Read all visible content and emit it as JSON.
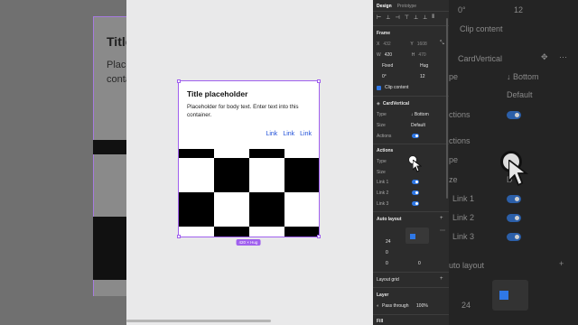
{
  "canvas": {
    "card_title": "Title placeholder",
    "card_body": "Placeholder for body text. Enter text into this container.",
    "links": [
      "Link",
      "Link",
      "Link"
    ],
    "size_tag": "420 × Hug"
  },
  "zoom_left": {
    "title": "Title",
    "body_line1": "Placeho",
    "body_line2": "contai"
  },
  "panel": {
    "tabs": [
      "Design",
      "Prototype"
    ],
    "frame_section": "Frame",
    "x_label": "X",
    "x_value": "432",
    "y_label": "Y",
    "y_value": "1608",
    "w_label": "W",
    "w_value": "420",
    "h_label": "H",
    "h_value": "470",
    "width_mode": "Fixed",
    "height_mode": "Hug",
    "rotation": "0°",
    "radius": "12",
    "clip_content": "Clip content",
    "component_name": "CardVertical",
    "type_label": "Type",
    "type_value": "↓ Bottom",
    "size_label": "Size",
    "size_value": "Default",
    "actions_label": "Actions",
    "actions_section": "Actions",
    "link1": "Link 1",
    "link2": "Link 2",
    "link3": "Link 3",
    "auto_layout": "Auto layout",
    "gap_value": "24",
    "pad_h": "0",
    "pad_v": "0",
    "pad_extra": "0",
    "layout_grid": "Layout grid",
    "layer_section": "Layer",
    "pass_through": "Pass through",
    "opacity": "100%",
    "fill_section": "Fill"
  },
  "zoom_right": {
    "rotation": "0°",
    "radius": "12",
    "clip_content": "Clip content",
    "component_name": "CardVertical",
    "type_partial": "pe",
    "type_value": "↓ Bottom",
    "size_value": "Default",
    "actions_partial": "ctions",
    "actions_section_partial": "ctions",
    "type2_partial": "pe",
    "size2_partial": "ze",
    "link1": "Link 1",
    "link2": "Link 2",
    "link3": "Link 3",
    "auto_layout": "uto layout",
    "gap_value": "24",
    "d_partial": "D"
  },
  "colors": {
    "accent": "#a060ee",
    "toggle_on": "#2f78e6",
    "link": "#1f4fd8",
    "panel_bg": "#2c2c2c"
  }
}
